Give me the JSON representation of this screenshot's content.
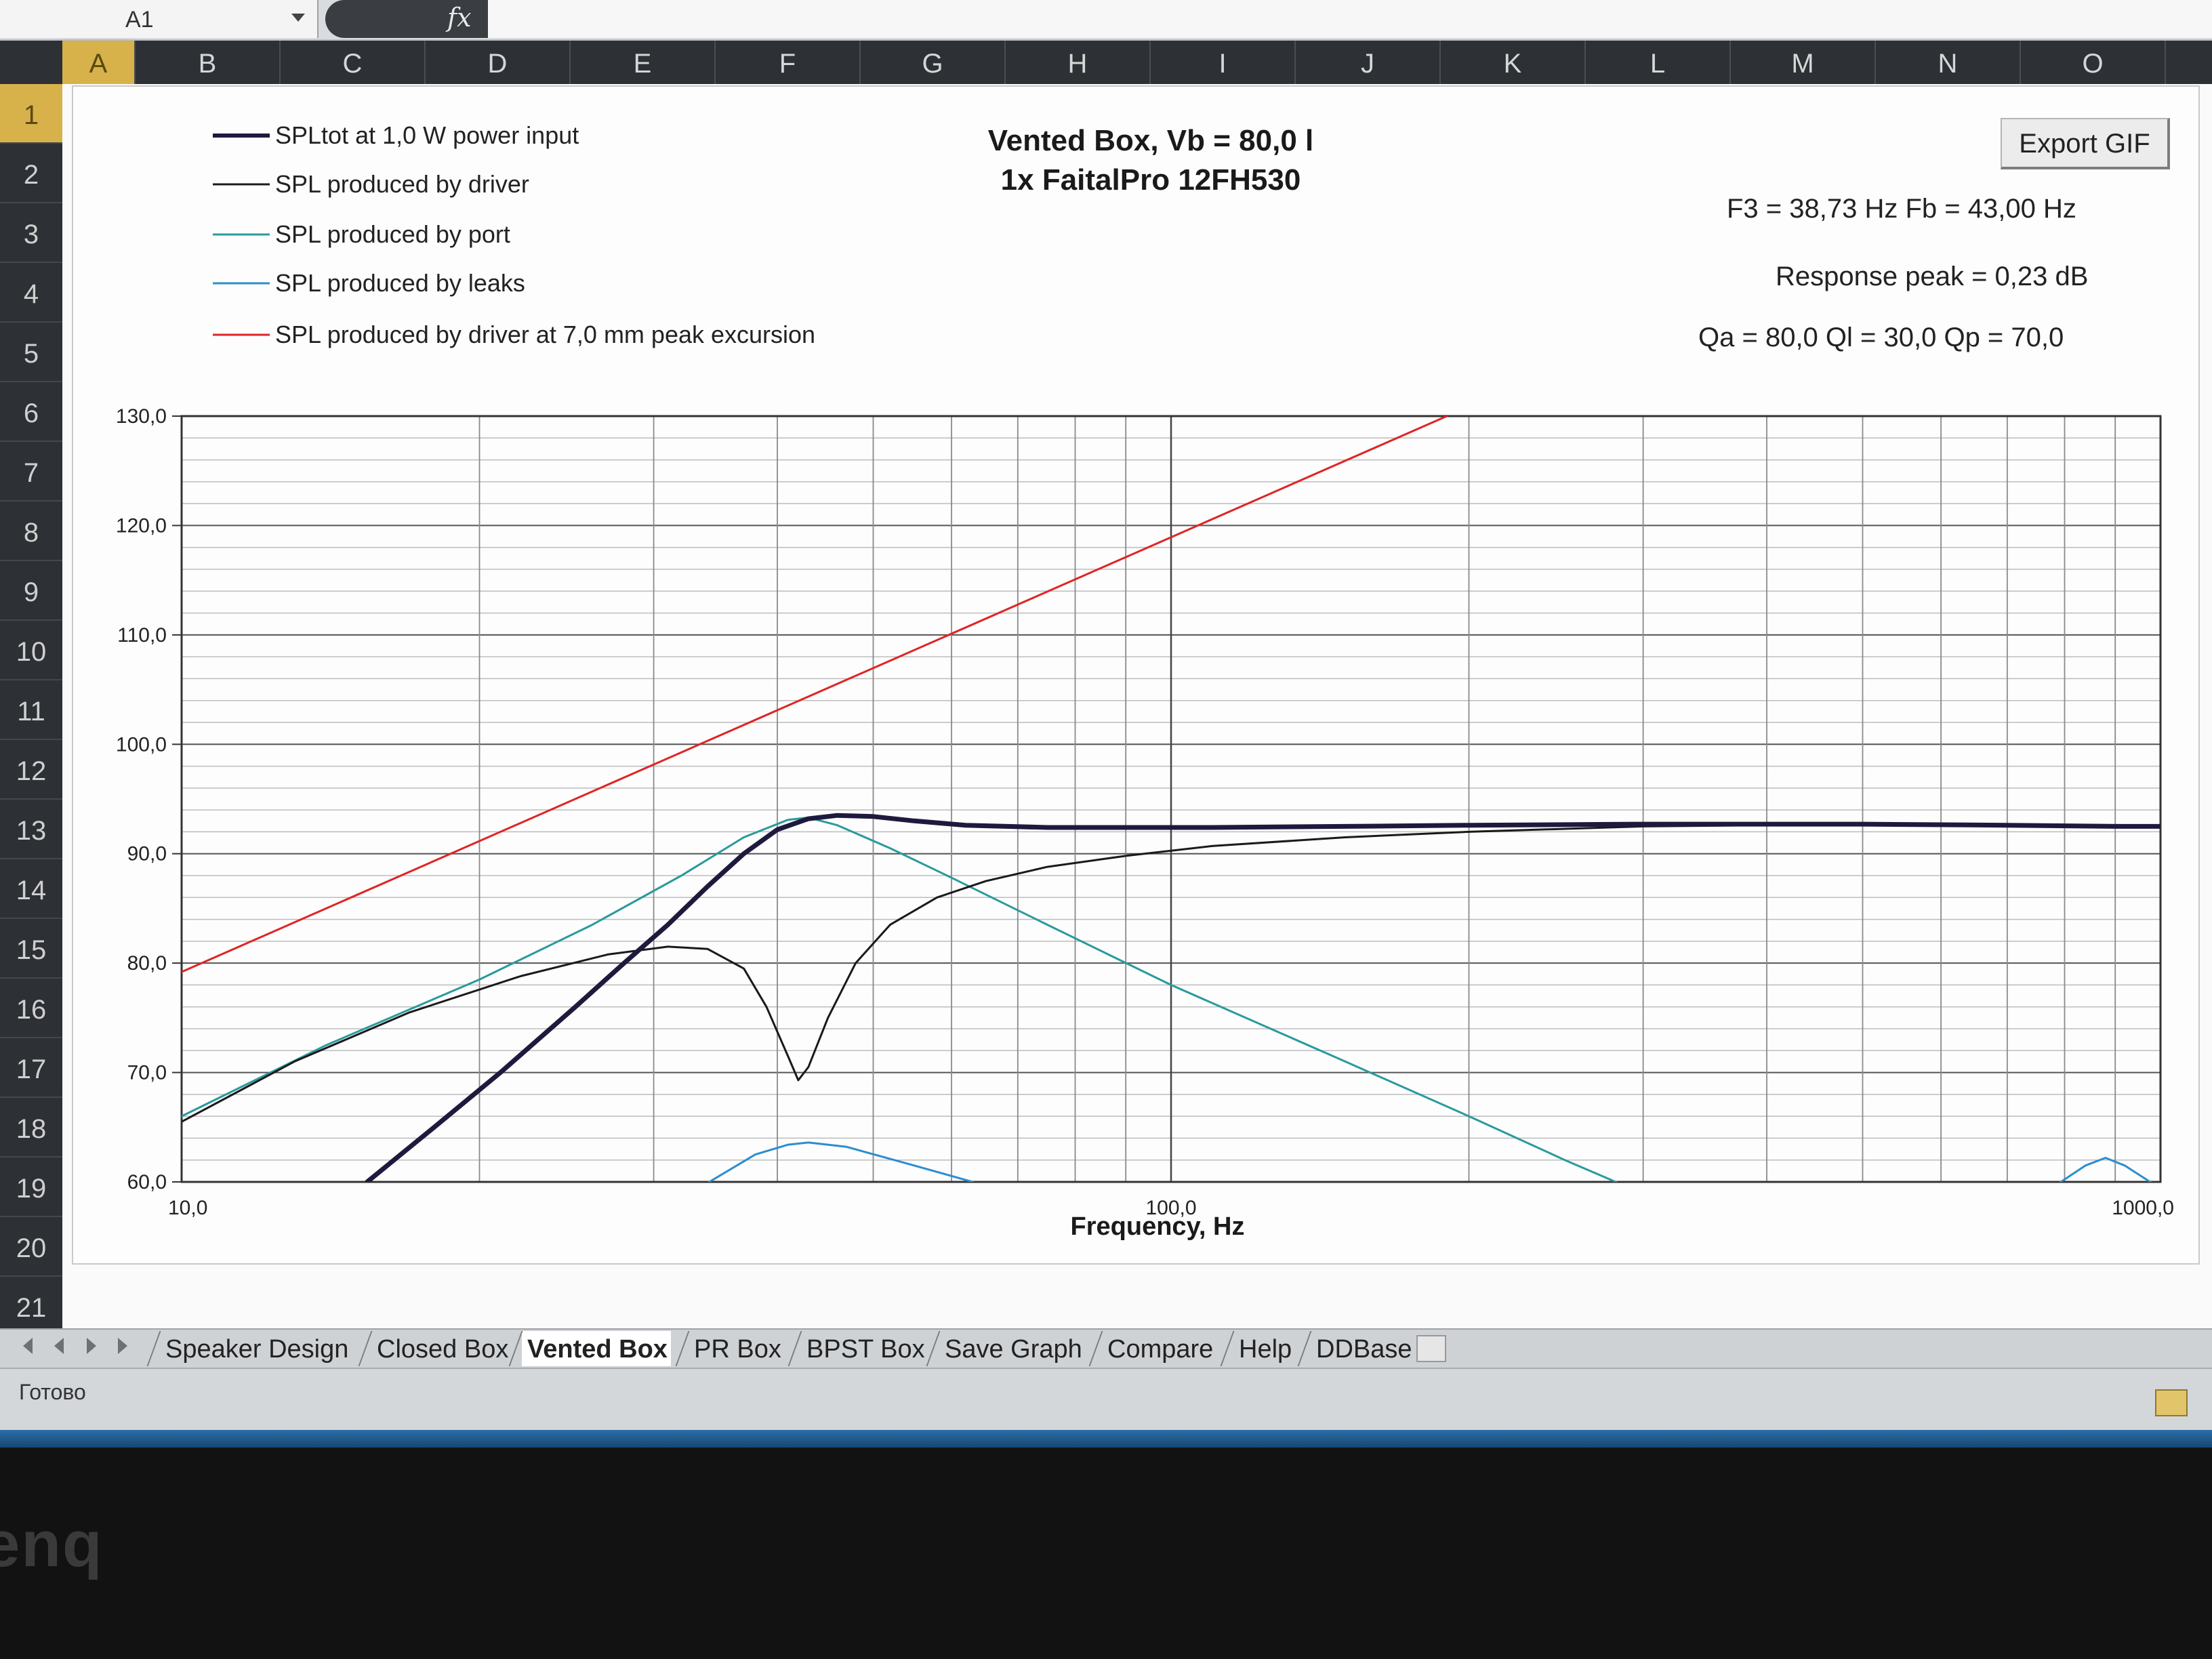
{
  "formula_bar": {
    "cell_ref": "A1",
    "fx_label": "fx"
  },
  "columns": [
    "A",
    "B",
    "C",
    "D",
    "E",
    "F",
    "G",
    "H",
    "I",
    "J",
    "K",
    "L",
    "M",
    "N",
    "O"
  ],
  "rows": [
    "1",
    "2",
    "3",
    "4",
    "5",
    "6",
    "7",
    "8",
    "9",
    "10",
    "11",
    "12",
    "13",
    "14",
    "15",
    "16",
    "17",
    "18",
    "19",
    "20",
    "21"
  ],
  "active_cell": {
    "column": "A",
    "row": "1"
  },
  "chart": {
    "title_line1": "Vented Box, Vb = 80,0 l",
    "title_line2": "1x FaitalPro 12FH530",
    "export_button": "Export GIF",
    "stats": {
      "f3_fb": "F3 = 38,73 Hz  Fb = 43,00 Hz",
      "response_peak": "Response peak = 0,23 dB",
      "q_values": "Qa = 80,0  Ql = 30,0  Qp = 70,0"
    }
  },
  "chart_data": {
    "type": "line",
    "title": "Vented Box, Vb = 80,0 l",
    "subtitle": "1x FaitalPro 12FH530",
    "xlabel": "Frequency, Hz",
    "ylabel": "",
    "x_scale": "log",
    "xlim": [
      10,
      1000
    ],
    "ylim": [
      60,
      130
    ],
    "x_tick_labels": [
      "10,0",
      "100,0",
      "1000,0"
    ],
    "x_ticks": [
      10,
      100,
      1000
    ],
    "y_tick_labels": [
      "60,0",
      "70,0",
      "80,0",
      "90,0",
      "100,0",
      "110,0",
      "120,0",
      "130,0"
    ],
    "y_ticks": [
      60,
      70,
      80,
      90,
      100,
      110,
      120,
      130
    ],
    "grid": true,
    "legend_position": "top-left",
    "series": [
      {
        "name": "SPLtot at 1,0 W power input",
        "color": "#1e1a3e",
        "line": "thick",
        "points": [
          [
            15.4,
            60
          ],
          [
            18,
            65
          ],
          [
            21,
            70
          ],
          [
            25,
            76
          ],
          [
            28,
            80
          ],
          [
            31,
            83.5
          ],
          [
            34,
            87
          ],
          [
            37,
            90
          ],
          [
            40,
            92.2
          ],
          [
            43,
            93.2
          ],
          [
            46,
            93.5
          ],
          [
            50,
            93.4
          ],
          [
            55,
            93.0
          ],
          [
            62,
            92.6
          ],
          [
            75,
            92.4
          ],
          [
            90,
            92.4
          ],
          [
            110,
            92.4
          ],
          [
            150,
            92.5
          ],
          [
            200,
            92.6
          ],
          [
            300,
            92.7
          ],
          [
            500,
            92.7
          ],
          [
            700,
            92.6
          ],
          [
            900,
            92.5
          ],
          [
            1000,
            92.5
          ]
        ]
      },
      {
        "name": "SPL produced by driver",
        "color": "#1a1a1a",
        "line": "thin",
        "points": [
          [
            10,
            65.5
          ],
          [
            13,
            71
          ],
          [
            17,
            75.5
          ],
          [
            22,
            78.8
          ],
          [
            27,
            80.8
          ],
          [
            31,
            81.5
          ],
          [
            34,
            81.3
          ],
          [
            37,
            79.5
          ],
          [
            39,
            76
          ],
          [
            41,
            71.5
          ],
          [
            42,
            69.3
          ],
          [
            43,
            70.5
          ],
          [
            45,
            75
          ],
          [
            48,
            80
          ],
          [
            52,
            83.5
          ],
          [
            58,
            86
          ],
          [
            65,
            87.5
          ],
          [
            75,
            88.8
          ],
          [
            90,
            89.8
          ],
          [
            110,
            90.7
          ],
          [
            150,
            91.5
          ],
          [
            200,
            92.0
          ],
          [
            300,
            92.5
          ],
          [
            500,
            92.7
          ],
          [
            1000,
            92.6
          ]
        ]
      },
      {
        "name": "SPL produced by port",
        "color": "#2a9a9c",
        "line": "thin",
        "points": [
          [
            10,
            66
          ],
          [
            14,
            72.5
          ],
          [
            20,
            78.5
          ],
          [
            26,
            83.5
          ],
          [
            32,
            88
          ],
          [
            37,
            91.5
          ],
          [
            41,
            93.1
          ],
          [
            43,
            93.3
          ],
          [
            46,
            92.6
          ],
          [
            52,
            90.5
          ],
          [
            60,
            87.8
          ],
          [
            75,
            83.5
          ],
          [
            100,
            78
          ],
          [
            150,
            71
          ],
          [
            200,
            66
          ],
          [
            250,
            62
          ],
          [
            290,
            59.5
          ]
        ]
      },
      {
        "name": "SPL produced by leaks",
        "color": "#2a8ed0",
        "line": "thin",
        "points": [
          [
            34,
            59.9
          ],
          [
            38,
            62.5
          ],
          [
            41,
            63.4
          ],
          [
            43,
            63.6
          ],
          [
            47,
            63.2
          ],
          [
            55,
            61.5
          ],
          [
            63,
            60
          ],
          [
            790,
            59.9
          ],
          [
            840,
            61.5
          ],
          [
            880,
            62.2
          ],
          [
            920,
            61.5
          ],
          [
            980,
            59.9
          ]
        ]
      },
      {
        "name": "SPL produced by driver at 7,0 mm peak excursion",
        "color": "#e02424",
        "line": "thin",
        "points": [
          [
            10,
            79.2
          ],
          [
            190,
            130.0
          ]
        ]
      }
    ]
  },
  "sheet_tabs": [
    "Speaker Design",
    "Closed Box",
    "Vented Box",
    "PR Box",
    "BPST Box",
    "Save Graph",
    "Compare",
    "Help",
    "DDBase"
  ],
  "active_tab": "Vented Box",
  "status": {
    "text": "Готово"
  },
  "monitor": {
    "brand": "enq"
  }
}
